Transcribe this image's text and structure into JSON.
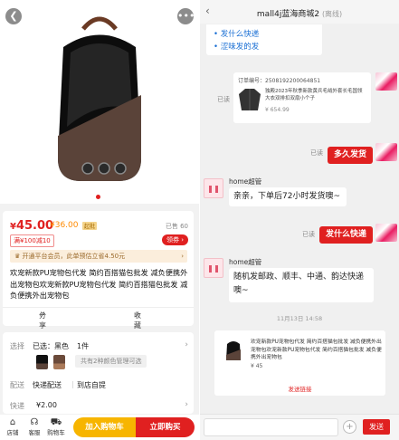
{
  "left": {
    "price": {
      "currency": "¥",
      "amount": "45.00",
      "original": "¥36.00",
      "tag": "起批",
      "sold": "已售 60"
    },
    "coupon": {
      "label": "满¥100减10",
      "get_label": "领券"
    },
    "promo": {
      "text": "开通平台会员，此单预估立省4.50元"
    },
    "title": "欢宠新款PU宠物包代发 简约百搭猫包批发 减负便携外出宠物包欢宠新款PU宠物包代发 简约百搭猫包批发 减负便携外出宠物包",
    "actions": {
      "share": "分享",
      "favorite": "收藏"
    },
    "options": {
      "select_label": "选择",
      "selected_text": "已选：黑色",
      "quantity": "1件",
      "colors_note": "共有2种颜色管理可选",
      "delivery_label": "配送",
      "delivery_value": "快递配送",
      "pickup": "到店自提",
      "express_label": "快递",
      "express_value": "¥2.00"
    },
    "bottom": {
      "shop": "店铺",
      "service": "客服",
      "cart": "购物车",
      "add_cart": "加入购物车",
      "buy_now": "立即购买"
    }
  },
  "right": {
    "header": {
      "title": "mall4j蓝海商城2",
      "status": "(离线)"
    },
    "faq": [
      "发什么快递",
      "涩味发的发"
    ],
    "order_card": {
      "number": "订单编号：2508192200064851",
      "desc": "独殿2023年秋季新款黄兵毛绒外套长毛国领大衣双排扣双扇小个子",
      "price": "¥ 654.99"
    },
    "read_label": "已读",
    "msg1": "多久发货",
    "sender": "home超管",
    "reply1": "亲亲，下单后72小时发货噢~",
    "msg2": "发什么快递",
    "reply2": "随机发邮政、顺丰、中通、韵达快递噢~",
    "timestamp": "11月13日 14:58",
    "product_card": {
      "title": "欢宠新款PU宠物包代发 简约百搭猫包批发 减负便携外出宠物包欢宠新款PU宠物包代发 简约百搭猫包批发 减负便携外出宠物包",
      "price": "¥ 45",
      "send_link": "发送链接"
    },
    "input": {
      "send": "发送"
    }
  }
}
